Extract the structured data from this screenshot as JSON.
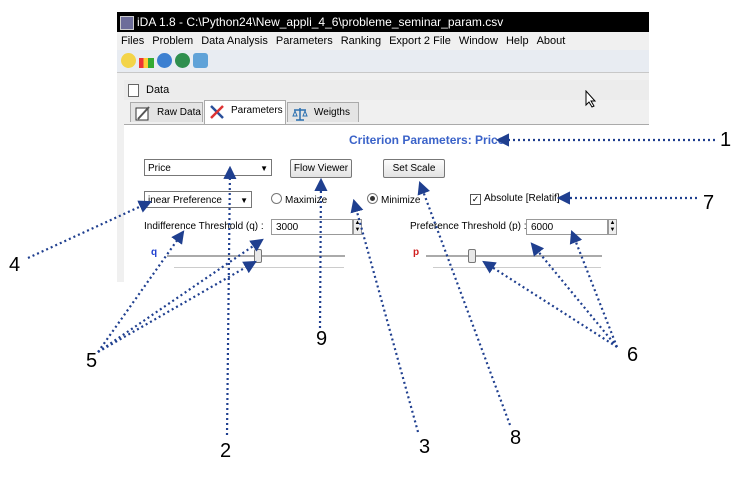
{
  "window": {
    "title": "iDA 1.8 - C:\\Python24\\New_appli_4_6\\probleme_seminar_param.csv"
  },
  "menu": [
    "Files",
    "Problem",
    "Data Analysis",
    "Parameters",
    "Ranking",
    "Export 2 File",
    "Window",
    "Help",
    "About"
  ],
  "toolbar": {
    "icons": [
      "lightbulb-icon",
      "bar-chart-icon",
      "globe-icon",
      "refresh-icon",
      "cube-icon"
    ]
  },
  "panel": {
    "title": "Data"
  },
  "tabs": [
    {
      "label": "Raw Data",
      "active": false
    },
    {
      "label": "Parameters",
      "active": true
    },
    {
      "label": "Weigths",
      "active": false
    }
  ],
  "params": {
    "criterion_title": "Criterion Parameters: Price",
    "criterion_select": "Price",
    "flow_viewer": "Flow Viewer",
    "set_scale": "Set Scale",
    "preference_function": "inear Preference",
    "maximize": "Maximize",
    "minimize": "Minimize",
    "absolute": "Absolute [Relatif]",
    "indiff_label": "Indifference Threshold (q) :",
    "indiff_value": "3000",
    "pref_label": "Preference Threshold (p) :",
    "pref_value": "6000",
    "q_label": "q",
    "p_label": "p"
  },
  "callouts": [
    "1",
    "2",
    "3",
    "4",
    "5",
    "6",
    "7",
    "8",
    "9"
  ]
}
